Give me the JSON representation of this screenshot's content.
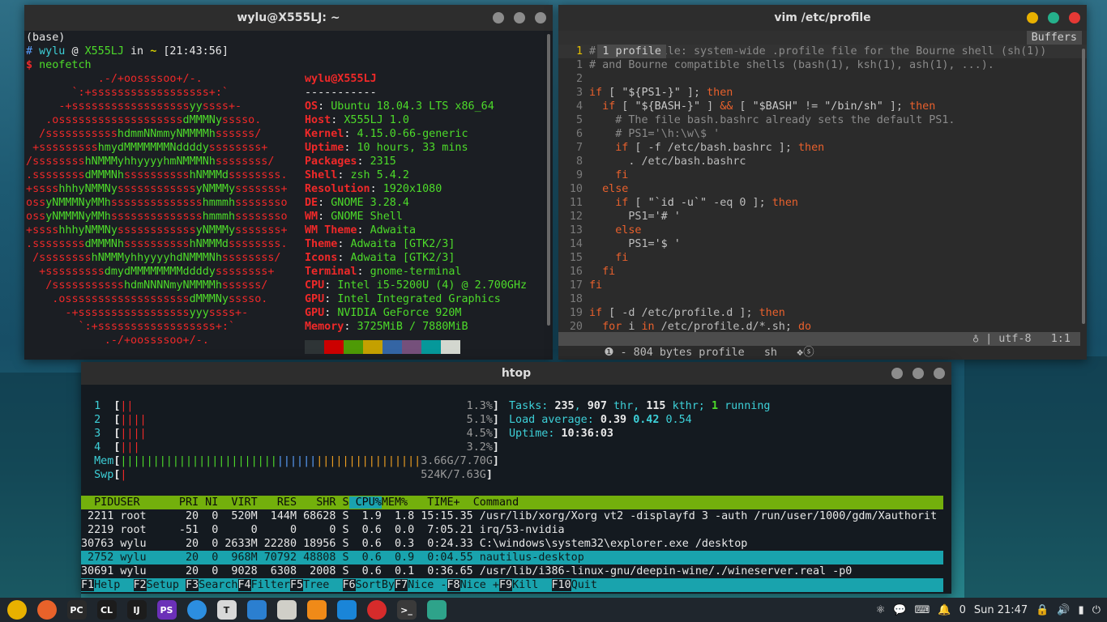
{
  "terminal": {
    "title": "wylu@X555LJ: ~",
    "env": "(base)",
    "prompt": {
      "hash": "#",
      "user": "wylu",
      "at": "@",
      "host": "X555LJ",
      "in": "in",
      "dir": "~",
      "time": "[21:43:56]"
    },
    "command_prompt": "$",
    "command": "neofetch",
    "logo": [
      "           .-/+oossssoo+/-.",
      "       `:+ssssssssssssssssss+:`",
      "     -+ssssssssssssssssssyyssss+-",
      "   .osssssssssssssssssssdMMMNysssso.",
      "  /ssssssssssshdmmNNmmyNMMMMhssssss/",
      " +ssssssssshmydMMMMMMMNddddyssssssss+",
      "/sssssssshNMMMyhhyyyyhmNMMMNhssssssss/",
      ".ssssssssdMMMNhsssssssssshNMMMdssssssss.",
      "+sssshhhyNMMNyssssssssssssyNMMMysssssss+",
      "ossyNMMMNyMMhsssssssssssssshmmmhssssssso",
      "ossyNMMMNyMMhsssssssssssssshmmmhssssssso",
      "+sssshhhyNMMNyssssssssssssyNMMMysssssss+",
      ".ssssssssdMMMNhsssssssssshNMMMdssssssss.",
      " /sssssssshNMMMyhhyyyyhdNMMMNhssssssss/",
      "  +sssssssssdmydMMMMMMMMddddyssssssss+",
      "   /ssssssssssshdmNNNNmyNMMMMhssssss/",
      "    .osssssssssssssssssssdMMMNysssso.",
      "      -+sssssssssssssssssyyyssss+-",
      "        `:+ssssssssssssssssss+:`",
      "            .-/+oossssoo+/-."
    ],
    "info_title": "wylu@X555LJ",
    "info_sep": "-----------",
    "info": [
      {
        "k": "OS",
        "v": "Ubuntu 18.04.3 LTS x86_64"
      },
      {
        "k": "Host",
        "v": "X555LJ 1.0"
      },
      {
        "k": "Kernel",
        "v": "4.15.0-66-generic"
      },
      {
        "k": "Uptime",
        "v": "10 hours, 33 mins"
      },
      {
        "k": "Packages",
        "v": "2315"
      },
      {
        "k": "Shell",
        "v": "zsh 5.4.2"
      },
      {
        "k": "Resolution",
        "v": "1920x1080"
      },
      {
        "k": "DE",
        "v": "GNOME 3.28.4"
      },
      {
        "k": "WM",
        "v": "GNOME Shell"
      },
      {
        "k": "WM Theme",
        "v": "Adwaita"
      },
      {
        "k": "Theme",
        "v": "Adwaita [GTK2/3]"
      },
      {
        "k": "Icons",
        "v": "Adwaita [GTK2/3]"
      },
      {
        "k": "Terminal",
        "v": "gnome-terminal"
      },
      {
        "k": "CPU",
        "v": "Intel i5-5200U (4) @ 2.700GHz"
      },
      {
        "k": "GPU",
        "v": "Intel Integrated Graphics"
      },
      {
        "k": "GPU",
        "v": "NVIDIA GeForce 920M"
      },
      {
        "k": "Memory",
        "v": "3725MiB / 7880MiB"
      }
    ],
    "palette": [
      "#2e3436",
      "#cc0000",
      "#4e9a06",
      "#c4a000",
      "#3465a4",
      "#75507b",
      "#06989a",
      "#d3d7cf"
    ]
  },
  "vim": {
    "title": "vim /etc/profile",
    "tab": "1 profile",
    "buffers": "Buffers",
    "lines": [
      {
        "n": "1",
        "t": "# /etc/profile: system-wide .profile file for the Bourne shell (sh(1))"
      },
      {
        "n": "1",
        "t": "# and Bourne compatible shells (bash(1), ksh(1), ash(1), ...)."
      },
      {
        "n": "2",
        "t": ""
      },
      {
        "n": "3",
        "t": "if [ \"${PS1-}\" ]; then"
      },
      {
        "n": "4",
        "t": "  if [ \"${BASH-}\" ] && [ \"$BASH\" != \"/bin/sh\" ]; then"
      },
      {
        "n": "5",
        "t": "    # The file bash.bashrc already sets the default PS1."
      },
      {
        "n": "6",
        "t": "    # PS1='\\h:\\w\\$ '"
      },
      {
        "n": "7",
        "t": "    if [ -f /etc/bash.bashrc ]; then"
      },
      {
        "n": "8",
        "t": "      . /etc/bash.bashrc"
      },
      {
        "n": "9",
        "t": "    fi"
      },
      {
        "n": "10",
        "t": "  else"
      },
      {
        "n": "11",
        "t": "    if [ \"`id -u`\" -eq 0 ]; then"
      },
      {
        "n": "12",
        "t": "      PS1='# '"
      },
      {
        "n": "13",
        "t": "    else"
      },
      {
        "n": "14",
        "t": "      PS1='$ '"
      },
      {
        "n": "15",
        "t": "    fi"
      },
      {
        "n": "16",
        "t": "  fi"
      },
      {
        "n": "17",
        "t": "fi"
      },
      {
        "n": "18",
        "t": ""
      },
      {
        "n": "19",
        "t": "if [ -d /etc/profile.d ]; then"
      },
      {
        "n": "20",
        "t": "  for i in /etc/profile.d/*.sh; do"
      }
    ],
    "status_left": " ❶ - 804 bytes profile   sh   ❖ⓢ",
    "status_right": "  ♁ | utf-8   1:1 "
  },
  "htop": {
    "title": "htop",
    "cpus": [
      {
        "n": "1",
        "bars": "||",
        "pct": "1.3%"
      },
      {
        "n": "2",
        "bars": "||||",
        "pct": "5.1%"
      },
      {
        "n": "3",
        "bars": "||||",
        "pct": "4.5%"
      },
      {
        "n": "4",
        "bars": "|||",
        "pct": "3.2%"
      }
    ],
    "mem": {
      "label": "Mem",
      "value": "3.66G/7.70G"
    },
    "swp": {
      "label": "Swp",
      "value": "524K/7.63G"
    },
    "tasks": {
      "label": "Tasks:",
      "procs": "235",
      "thr": "907",
      "thr_label": "thr,",
      "kthr": "115",
      "kthr_label": "kthr;",
      "running": "1",
      "running_label": "running"
    },
    "load": {
      "label": "Load average:",
      "v1": "0.39",
      "v2": "0.42",
      "v3": "0.54"
    },
    "uptime": {
      "label": "Uptime:",
      "value": "10:36:03"
    },
    "columns": [
      "  PID",
      "USER     ",
      " PRI",
      " NI",
      "  VIRT",
      "   RES",
      "   SHR",
      " S",
      "CPU%",
      "MEM%",
      "   TIME+ ",
      " Command"
    ],
    "rows": [
      {
        "pid": " 2211",
        "user": "root    ",
        "pri": "  20",
        "ni": "  0",
        "virt": "  520M",
        "res": "  144M",
        "shr": " 68628",
        "s": " S",
        "cpu": "  1.9",
        "mem": "  1.8",
        "time": " 15:15.35",
        "cmd": " /usr/lib/xorg/Xorg vt2 -displayfd 3 -auth /run/user/1000/gdm/Xauthorit"
      },
      {
        "pid": " 2219",
        "user": "root    ",
        "pri": " -51",
        "ni": "  0",
        "virt": "     0",
        "res": "     0",
        "shr": "     0",
        "s": " S",
        "cpu": "  0.6",
        "mem": "  0.0",
        "time": "  7:05.21",
        "cmd": " irq/53-nvidia"
      },
      {
        "pid": "30763",
        "user": "wylu    ",
        "pri": "  20",
        "ni": "  0",
        "virt": " 2633M",
        "res": " 22280",
        "shr": " 18956",
        "s": " S",
        "cpu": "  0.6",
        "mem": "  0.3",
        "time": "  0:24.33",
        "cmd": " C:\\windows\\system32\\explorer.exe /desktop"
      },
      {
        "pid": " 2752",
        "user": "wylu    ",
        "pri": "  20",
        "ni": "  0",
        "virt": "  968M",
        "res": " 70792",
        "shr": " 48808",
        "s": " S",
        "cpu": "  0.6",
        "mem": "  0.9",
        "time": "  0:04.55",
        "cmd": " nautilus-desktop"
      },
      {
        "pid": "30691",
        "user": "wylu    ",
        "pri": "  20",
        "ni": "  0",
        "virt": "  9028",
        "res": "  6308",
        "shr": "  2008",
        "s": " S",
        "cpu": "  0.6",
        "mem": "  0.1",
        "time": "  0:36.65",
        "cmd": " /usr/lib/i386-linux-gnu/deepin-wine/./wineserver.real -p0"
      }
    ],
    "selected_row": 3,
    "fkeys": [
      {
        "k": "F1",
        "l": "Help  "
      },
      {
        "k": "F2",
        "l": "Setup "
      },
      {
        "k": "F3",
        "l": "Search"
      },
      {
        "k": "F4",
        "l": "Filter"
      },
      {
        "k": "F5",
        "l": "Tree  "
      },
      {
        "k": "F6",
        "l": "SortBy"
      },
      {
        "k": "F7",
        "l": "Nice -"
      },
      {
        "k": "F8",
        "l": "Nice +"
      },
      {
        "k": "F9",
        "l": "Kill  "
      },
      {
        "k": "F10",
        "l": "Quit"
      }
    ]
  },
  "taskbar": {
    "apps": [
      {
        "name": "chrome-icon",
        "label": "",
        "color": "#e8b100"
      },
      {
        "name": "firefox-icon",
        "label": "",
        "color": "#e8622a"
      },
      {
        "name": "pycharm-icon",
        "label": "PC",
        "color": "#2a2a2a"
      },
      {
        "name": "clion-icon",
        "label": "CL",
        "color": "#1c1c1c"
      },
      {
        "name": "intellij-icon",
        "label": "IJ",
        "color": "#1c1c1c"
      },
      {
        "name": "phpstorm-icon",
        "label": "PS",
        "color": "#6b30b8"
      },
      {
        "name": "qq-icon",
        "label": "",
        "color": "#2c8ee0"
      },
      {
        "name": "typora-icon",
        "label": "T",
        "color": "#d8d8d8"
      },
      {
        "name": "xmind-icon",
        "label": "",
        "color": "#2b7fd0"
      },
      {
        "name": "files-icon",
        "label": "",
        "color": "#d0cfc8"
      },
      {
        "name": "sublime-icon",
        "label": "",
        "color": "#f08a18"
      },
      {
        "name": "vscode-icon",
        "label": "",
        "color": "#1a85d8"
      },
      {
        "name": "netease-music-icon",
        "label": "",
        "color": "#d62b2b"
      },
      {
        "name": "terminal-icon",
        "label": ">_",
        "color": "#3a3a3a"
      },
      {
        "name": "settings-app-icon",
        "label": "",
        "color": "#2ea38a"
      }
    ],
    "notif_count": "0",
    "clock": "Sun 21:47"
  }
}
